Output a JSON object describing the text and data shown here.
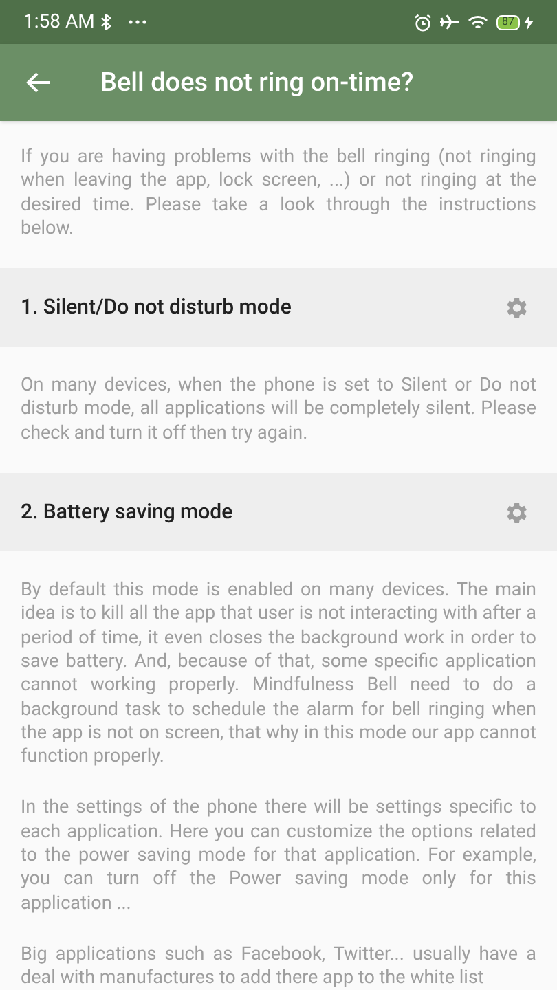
{
  "status_bar": {
    "time": "1:58 AM",
    "battery": "87"
  },
  "app_bar": {
    "title": "Bell does not ring on-time?"
  },
  "intro": "If you are having problems with the bell ringing (not ringing when leaving the app, lock screen, ...) or not ringing at the desired time. Please take a look through the instructions below.",
  "sections": [
    {
      "title": "1. Silent/Do not disturb mode",
      "paragraphs": [
        "On many devices, when the phone is set to Silent or Do not disturb mode, all applications will be completely silent. Please check and turn it off then try again."
      ]
    },
    {
      "title": "2. Battery saving mode",
      "paragraphs": [
        "By default this mode is enabled on many devices. The main idea is to kill all the app that user is not interacting with after a period of time, it even closes the background work in order to save battery. And, because of that, some specific application cannot working properly. Mindfulness Bell need to do a background task to schedule the alarm for bell ringing when the app is not on screen, that why in this mode our app cannot function properly.",
        "In the settings of the phone there will be settings specific to each application. Here you can customize the options related to the power saving mode for that application. For example, you can turn off the Power saving mode only for this application ...",
        "Big applications such as Facebook, Twitter... usually have a deal with manufactures to add there app to the white list"
      ]
    }
  ]
}
